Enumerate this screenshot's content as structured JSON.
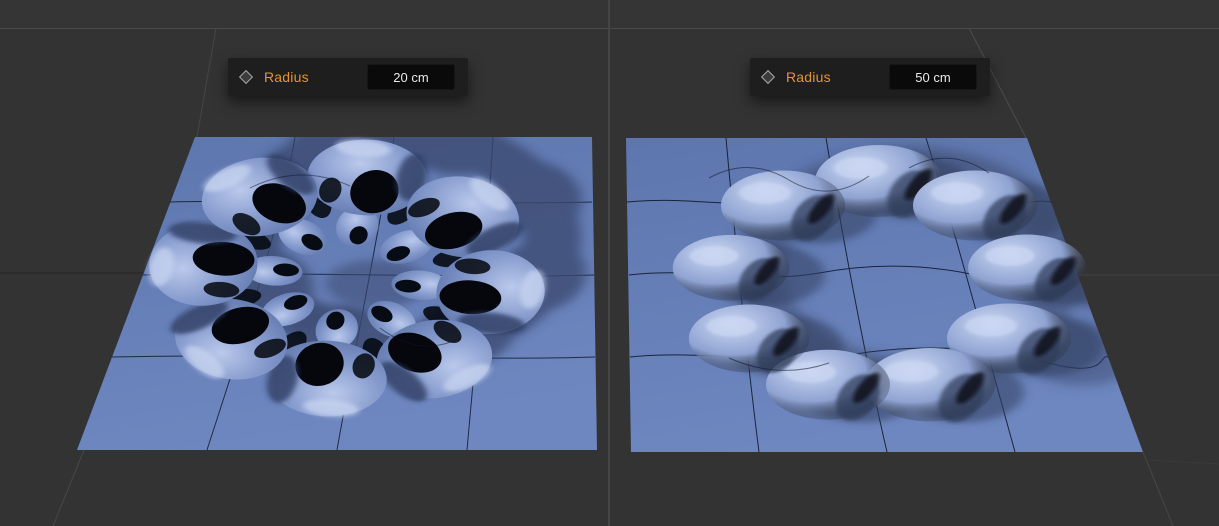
{
  "panels": [
    {
      "icon": "diamond-handle-icon",
      "label": "Radius",
      "value": "20 cm"
    },
    {
      "icon": "diamond-handle-icon",
      "label": "Radius",
      "value": "50 cm"
    }
  ],
  "viewports": [
    {
      "name": "perspective-view-radius-20"
    },
    {
      "name": "perspective-view-radius-50"
    }
  ],
  "colors": {
    "viewport_background": "#333333",
    "divider": "#4a4a4a",
    "panel_background": "#1e1e1e",
    "value_box_background": "#0a0a0a",
    "label_orange": "#e39435",
    "value_text": "#e9e9e9",
    "plane_top": "#5d76ae",
    "plane_bottom": "#6e87c0",
    "cast_shadow": "#3a4870",
    "wireframe": "#0d1526",
    "surface_highlight": "#ccd8f3",
    "dark_fold": "#05070d"
  }
}
